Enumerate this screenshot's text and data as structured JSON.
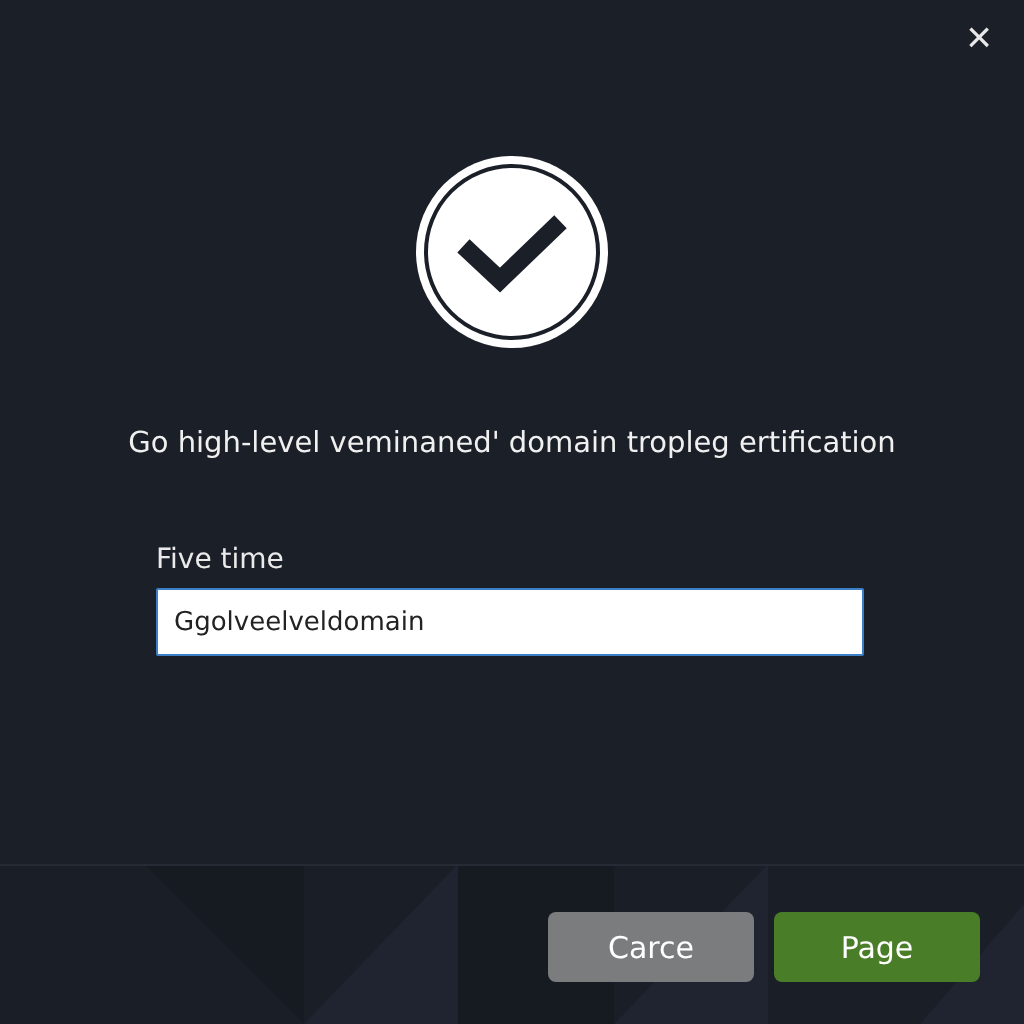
{
  "dialog": {
    "close": "×",
    "message": "Go high-level veminaned' domain tropleg ertification",
    "field": {
      "label": "Five time",
      "value": "Ggolveelveldomain"
    },
    "buttons": [
      {
        "label": "Carce",
        "kind": "secondary"
      },
      {
        "label": "Page",
        "kind": "primary"
      }
    ]
  }
}
